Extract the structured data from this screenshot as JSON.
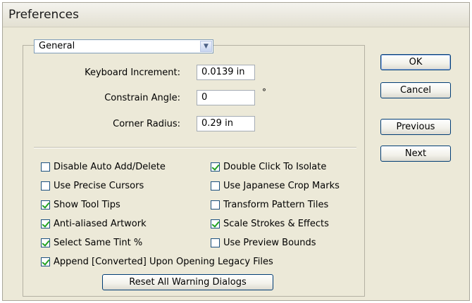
{
  "window": {
    "title": "Preferences"
  },
  "section_select": {
    "value": "General",
    "arrow_icon": "chevron-down-icon"
  },
  "fields": {
    "keyboard_increment": {
      "label": "Keyboard Increment:",
      "value": "0.0139 in"
    },
    "constrain_angle": {
      "label": "Constrain Angle:",
      "value": "0",
      "unit": "°"
    },
    "corner_radius": {
      "label": "Corner Radius:",
      "value": "0.29 in"
    }
  },
  "options": [
    {
      "label": "Disable Auto Add/Delete",
      "checked": false
    },
    {
      "label": "Double Click To Isolate",
      "checked": true
    },
    {
      "label": "Use Precise Cursors",
      "checked": false
    },
    {
      "label": "Use Japanese Crop Marks",
      "checked": false
    },
    {
      "label": "Show Tool Tips",
      "checked": true
    },
    {
      "label": "Transform Pattern Tiles",
      "checked": false
    },
    {
      "label": "Anti-aliased Artwork",
      "checked": true
    },
    {
      "label": "Scale Strokes & Effects",
      "checked": true
    },
    {
      "label": "Select Same Tint %",
      "checked": true
    },
    {
      "label": "Use Preview Bounds",
      "checked": false
    },
    {
      "label": "Append [Converted] Upon Opening Legacy Files",
      "checked": true
    }
  ],
  "buttons": {
    "reset_warnings": "Reset All Warning Dialogs",
    "ok": "OK",
    "cancel": "Cancel",
    "previous": "Previous",
    "next": "Next"
  },
  "colors": {
    "dialog_bg": "#ece9d8",
    "check_green": "#21a121",
    "button_border": "#003c74"
  }
}
